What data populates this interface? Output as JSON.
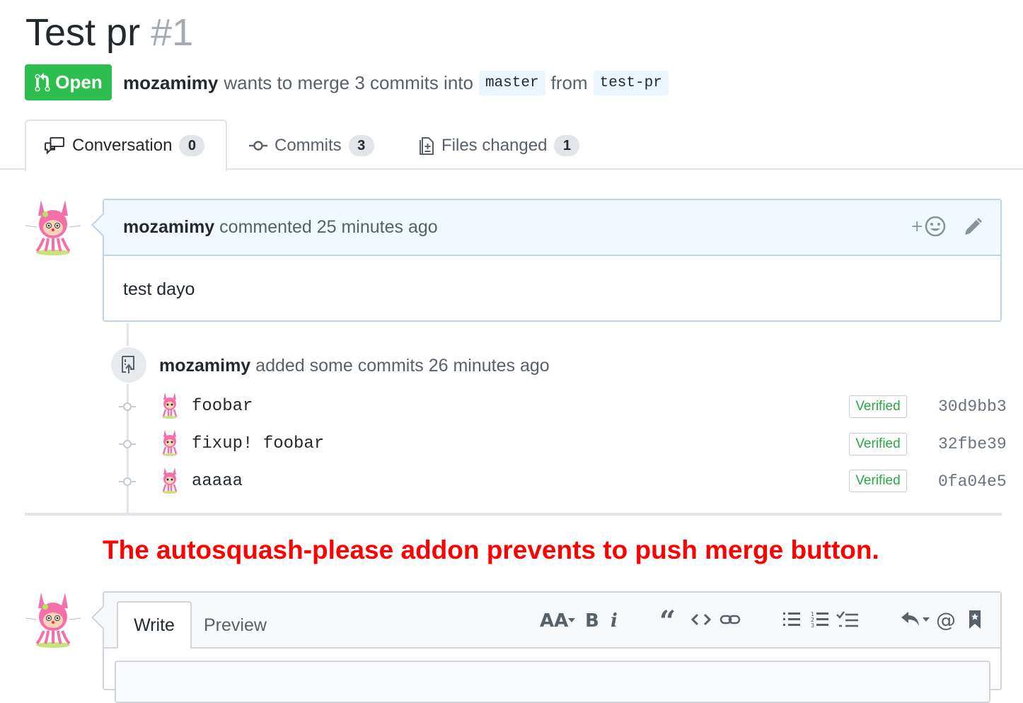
{
  "pr": {
    "title": "Test pr",
    "number": "#1",
    "state": "Open",
    "author": "mozamimy",
    "merge_text": "wants to merge 3 commits into",
    "base_branch": "master",
    "from_text": "from",
    "head_branch": "test-pr"
  },
  "tabs": [
    {
      "label": "Conversation",
      "count": "0",
      "icon": "comment-discussion-icon"
    },
    {
      "label": "Commits",
      "count": "3",
      "icon": "git-commit-icon"
    },
    {
      "label": "Files changed",
      "count": "1",
      "icon": "diff-icon"
    }
  ],
  "comment": {
    "author": "mozamimy",
    "action": "commented 25 minutes ago",
    "body": "test dayo"
  },
  "commits_event": {
    "author": "mozamimy",
    "action": "added some commits 26 minutes ago",
    "commits": [
      {
        "message": "foobar",
        "badge": "Verified",
        "sha": "30d9bb3"
      },
      {
        "message": "fixup! foobar",
        "badge": "Verified",
        "sha": "32fbe39"
      },
      {
        "message": "aaaaa",
        "badge": "Verified",
        "sha": "0fa04e5"
      }
    ]
  },
  "annotation": "The autosquash-please addon prevents to push merge button.",
  "editor": {
    "write_tab": "Write",
    "preview_tab": "Preview",
    "toolbar": [
      "text-size-icon",
      "bold-icon",
      "italic-icon",
      "quote-icon",
      "code-icon",
      "link-icon",
      "unordered-list-icon",
      "ordered-list-icon",
      "task-list-icon",
      "reply-icon",
      "mention-icon",
      "bookmark-icon"
    ]
  },
  "colors": {
    "open_green": "#2cbe4e",
    "annotation_red": "#ff0000",
    "comment_header_bg": "#f1f8ff",
    "verified_green": "#28a745"
  }
}
